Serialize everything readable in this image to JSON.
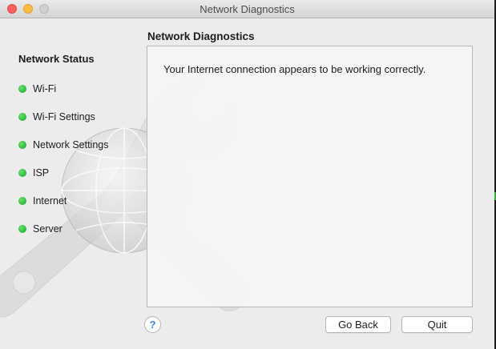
{
  "window": {
    "title": "Network Diagnostics"
  },
  "sidebar": {
    "heading": "Network Status",
    "items": [
      {
        "label": "Wi-Fi",
        "status": "green"
      },
      {
        "label": "Wi-Fi Settings",
        "status": "green"
      },
      {
        "label": "Network Settings",
        "status": "green"
      },
      {
        "label": "ISP",
        "status": "green"
      },
      {
        "label": "Internet",
        "status": "green"
      },
      {
        "label": "Server",
        "status": "green"
      }
    ]
  },
  "main": {
    "title": "Network Diagnostics",
    "message": "Your Internet connection appears to be working correctly."
  },
  "buttons": {
    "help": "?",
    "go_back": "Go Back",
    "quit": "Quit"
  },
  "colors": {
    "status_green": "#2fbf41",
    "help_blue": "#3b88e8"
  }
}
